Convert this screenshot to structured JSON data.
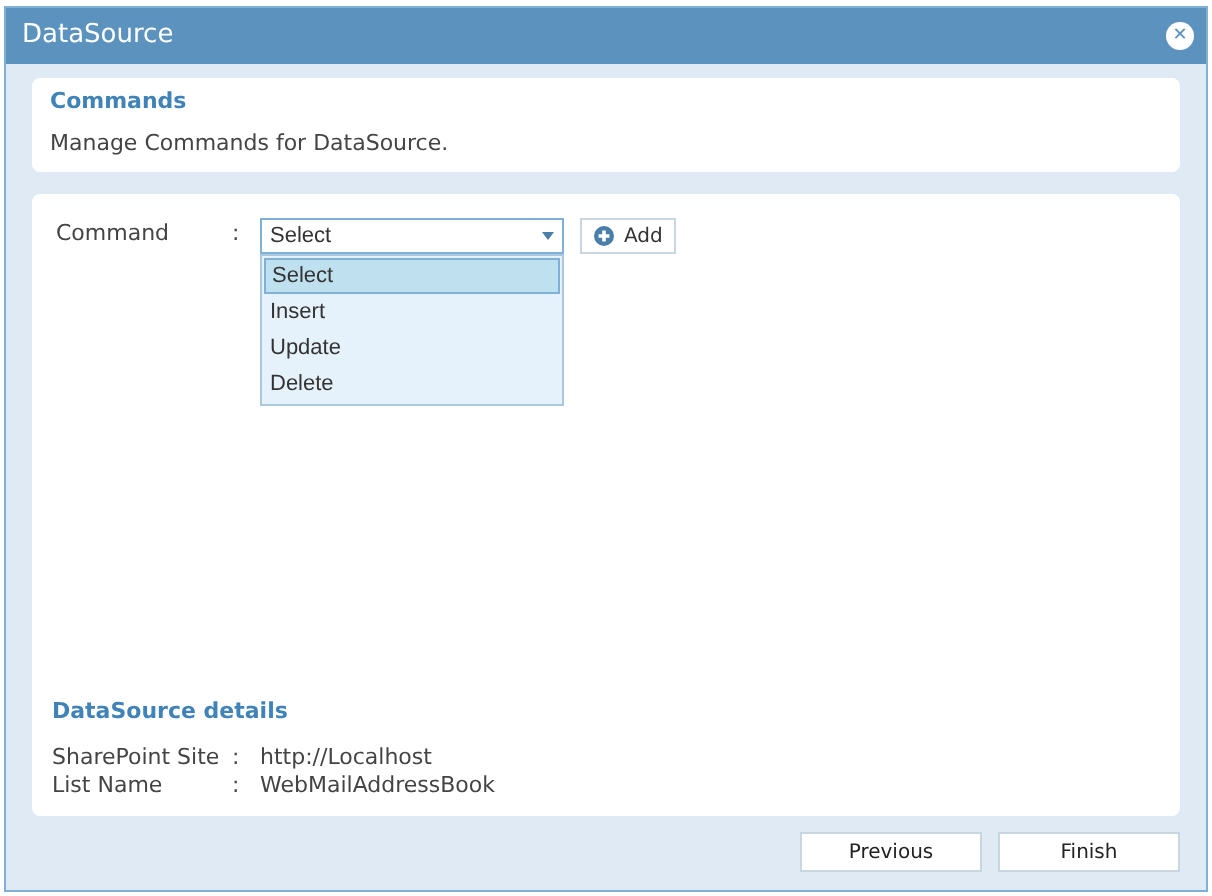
{
  "window": {
    "title": "DataSource",
    "close": "✕"
  },
  "header": {
    "title": "Commands",
    "description": "Manage Commands for DataSource."
  },
  "command": {
    "label": "Command",
    "colon": ":",
    "value": "Select",
    "expanded": true,
    "options": [
      {
        "label": "Select",
        "selected": true
      },
      {
        "label": "Insert",
        "selected": false
      },
      {
        "label": "Update",
        "selected": false
      },
      {
        "label": "Delete",
        "selected": false
      }
    ],
    "add_button": "Add"
  },
  "details": {
    "title": "DataSource details",
    "rows": [
      {
        "label": "SharePoint Site",
        "colon": ":",
        "value": "http://Localhost"
      },
      {
        "label": "List Name",
        "colon": ":",
        "value": "WebMailAddressBook"
      }
    ]
  },
  "buttons": [
    "Previous",
    "Finish"
  ]
}
